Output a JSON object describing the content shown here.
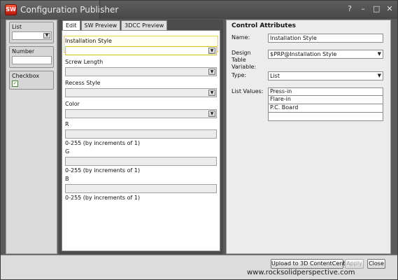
{
  "window": {
    "title": "Configuration Publisher",
    "app_icon_text": "SW",
    "controls": [
      "?",
      "–",
      "□",
      "✕"
    ]
  },
  "left_panel": {
    "list_label": "List",
    "number_label": "Number",
    "checkbox_label": "Checkbox",
    "checkbox_mark": "✓"
  },
  "center": {
    "tabs": [
      {
        "label": "Edit"
      },
      {
        "label": "SW Preview"
      },
      {
        "label": "3DCC Preview"
      }
    ],
    "fields": {
      "installation_style": "Installation Style",
      "screw_length": "Screw Length",
      "recess_style": "Recess Style",
      "color": "Color",
      "r": "R",
      "r_hint": "0-255 (by increments of 1)",
      "g": "G",
      "g_hint": "0-255 (by increments of 1)",
      "b": "B",
      "b_hint": "0-255 (by increments of 1)"
    }
  },
  "control_attributes": {
    "title": "Control Attributes",
    "name_label": "Name:",
    "name_value": "Installation Style",
    "design_table_label": "Design Table Variable:",
    "design_table_value": "$PRP@Installation Style",
    "type_label": "Type:",
    "type_value": "List",
    "list_values_label": "List Values:",
    "list_values": [
      "Press-in",
      "Flare-in",
      "P.C. Board",
      ""
    ]
  },
  "footer": {
    "upload_button": "Upload to 3D ContentCentral",
    "apply_button": "Apply",
    "close_button": "Close",
    "watermark": "www.rocksolidperspective.com"
  }
}
